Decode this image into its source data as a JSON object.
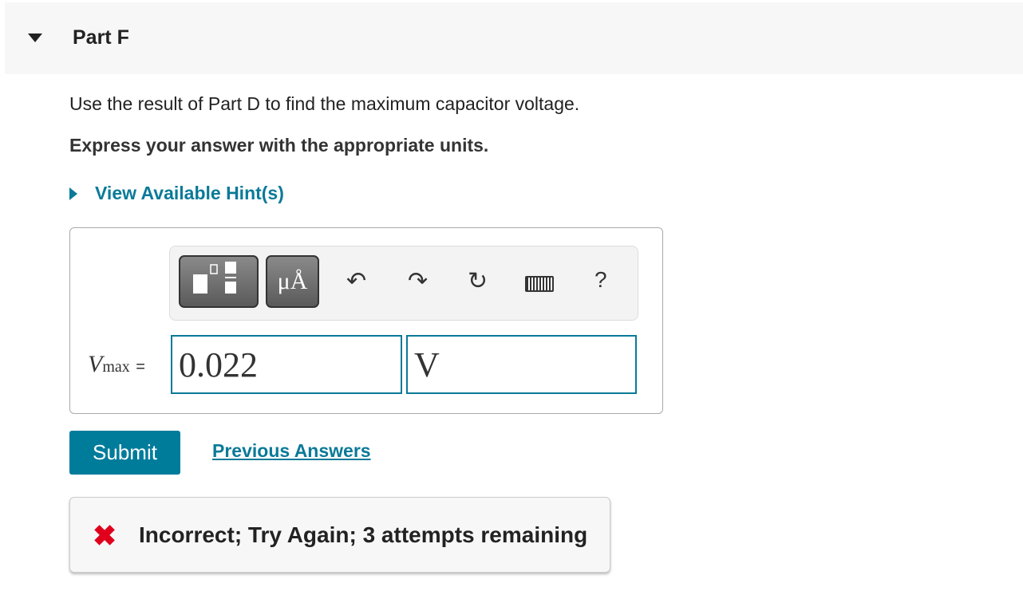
{
  "header": {
    "title": "Part F",
    "collapse_icon": "caret-down-icon"
  },
  "question": "Use the result of Part D to find the maximum capacitor voltage.",
  "instruction": "Express your answer with the appropriate units.",
  "hint_label": "View Available Hint(s)",
  "toolbar": {
    "units_label": "μÅ",
    "help_label": "?",
    "icons": [
      "templates-icon",
      "units-icon",
      "undo-icon",
      "redo-icon",
      "reset-icon",
      "keyboard-icon",
      "help-icon"
    ]
  },
  "answer": {
    "label": "V",
    "subscript": "max",
    "equals": "=",
    "value": "0.022",
    "unit": "V"
  },
  "submit_label": "Submit",
  "previous_answers_label": "Previous Answers",
  "feedback": {
    "text": "Incorrect; Try Again; 3 attempts remaining",
    "icon": "x-icon",
    "color": "#e0001b"
  },
  "accent": "#007c9b"
}
